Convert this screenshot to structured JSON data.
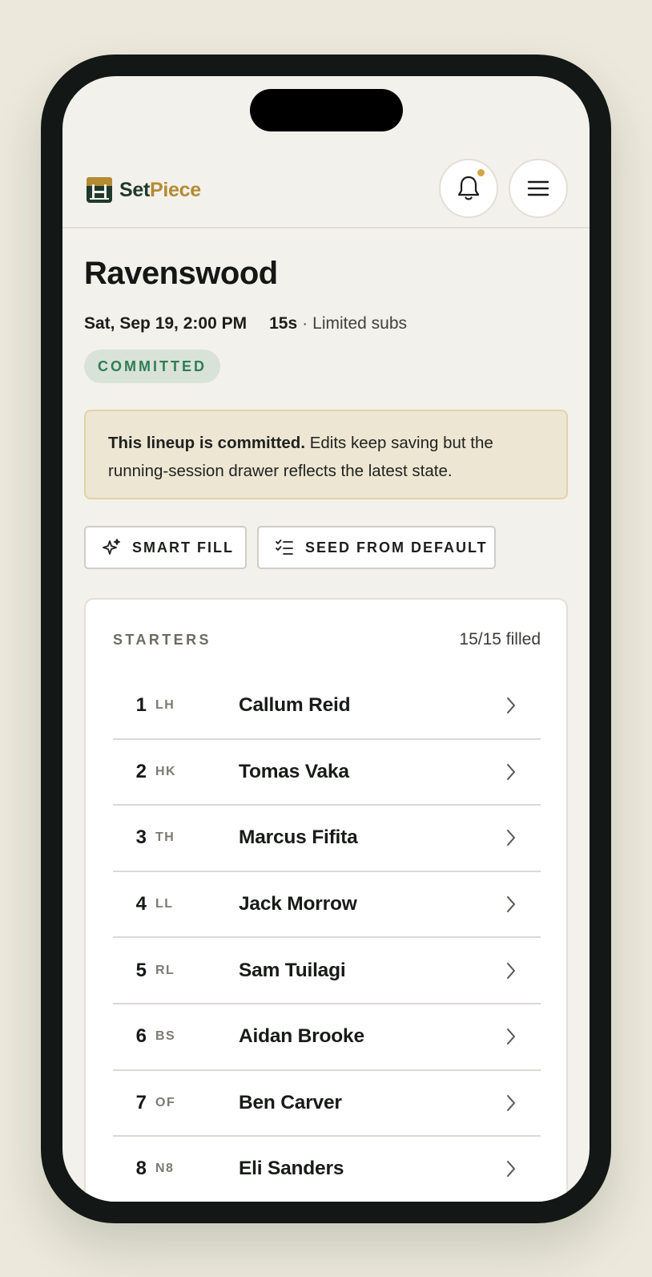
{
  "app": {
    "brand_part1": "Set",
    "brand_part2": "Piece",
    "brand_colors": {
      "primary": "#1f3a2c",
      "accent": "#b48a32"
    }
  },
  "header": {
    "bell_icon": "bell-icon",
    "menu_icon": "hamburger-menu-icon",
    "has_notification": true
  },
  "match": {
    "opponent": "Ravenswood",
    "datetime": "Sat, Sep 19, 2:00 PM",
    "format": "15s",
    "separator": "·",
    "subs_rule": "Limited subs",
    "status": "COMMITTED"
  },
  "notice": {
    "bold": "This lineup is committed.",
    "text": " Edits keep saving but the running-session drawer reflects the latest state."
  },
  "actions": {
    "smart_fill": "SMART FILL",
    "seed_default": "SEED FROM DEFAULT"
  },
  "starters": {
    "label": "STARTERS",
    "count": "15/15 filled",
    "rows": [
      {
        "num": "1",
        "pos": "LH",
        "name": "Callum Reid"
      },
      {
        "num": "2",
        "pos": "HK",
        "name": "Tomas Vaka"
      },
      {
        "num": "3",
        "pos": "TH",
        "name": "Marcus Fifita"
      },
      {
        "num": "4",
        "pos": "LL",
        "name": "Jack Morrow"
      },
      {
        "num": "5",
        "pos": "RL",
        "name": "Sam Tuilagi"
      },
      {
        "num": "6",
        "pos": "BS",
        "name": "Aidan Brooke"
      },
      {
        "num": "7",
        "pos": "OF",
        "name": "Ben Carver"
      },
      {
        "num": "8",
        "pos": "N8",
        "name": "Eli Sanders"
      }
    ]
  }
}
